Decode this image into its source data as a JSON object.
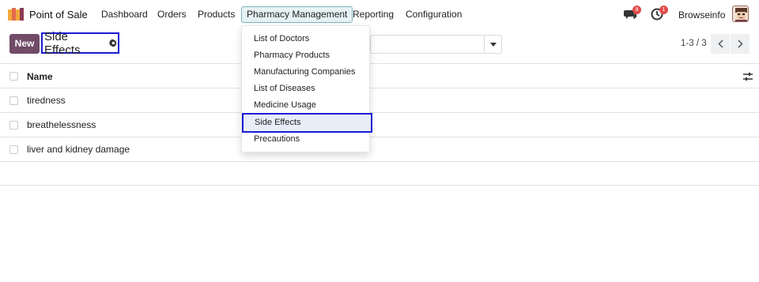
{
  "navbar": {
    "app_name": "Point of Sale",
    "menu": [
      {
        "label": "Dashboard"
      },
      {
        "label": "Orders"
      },
      {
        "label": "Products"
      },
      {
        "label": "Pharmacy Management"
      },
      {
        "label": "Reporting"
      },
      {
        "label": "Configuration"
      }
    ],
    "messages_badge": "8",
    "activities_badge": "1",
    "user_name": "Browseinfo"
  },
  "control_panel": {
    "new_button_label": "New",
    "breadcrumb_title": "Side Effects",
    "pager_value": "1-3 / 3"
  },
  "list": {
    "column_header": "Name",
    "rows": [
      {
        "name": "tiredness"
      },
      {
        "name": "breathelessness"
      },
      {
        "name": "liver and kidney damage"
      }
    ]
  },
  "dropdown": {
    "items": [
      {
        "label": "List of Doctors"
      },
      {
        "label": "Pharmacy Products"
      },
      {
        "label": "Manufacturing Companies"
      },
      {
        "label": "List of Diseases"
      },
      {
        "label": "Medicine Usage"
      },
      {
        "label": "Side Effects"
      },
      {
        "label": "Precautions"
      }
    ],
    "selected": "Side Effects"
  },
  "colors": {
    "brand": "#714b67",
    "highlight_border": "#1b1bd2",
    "badge": "#e44b4b"
  }
}
